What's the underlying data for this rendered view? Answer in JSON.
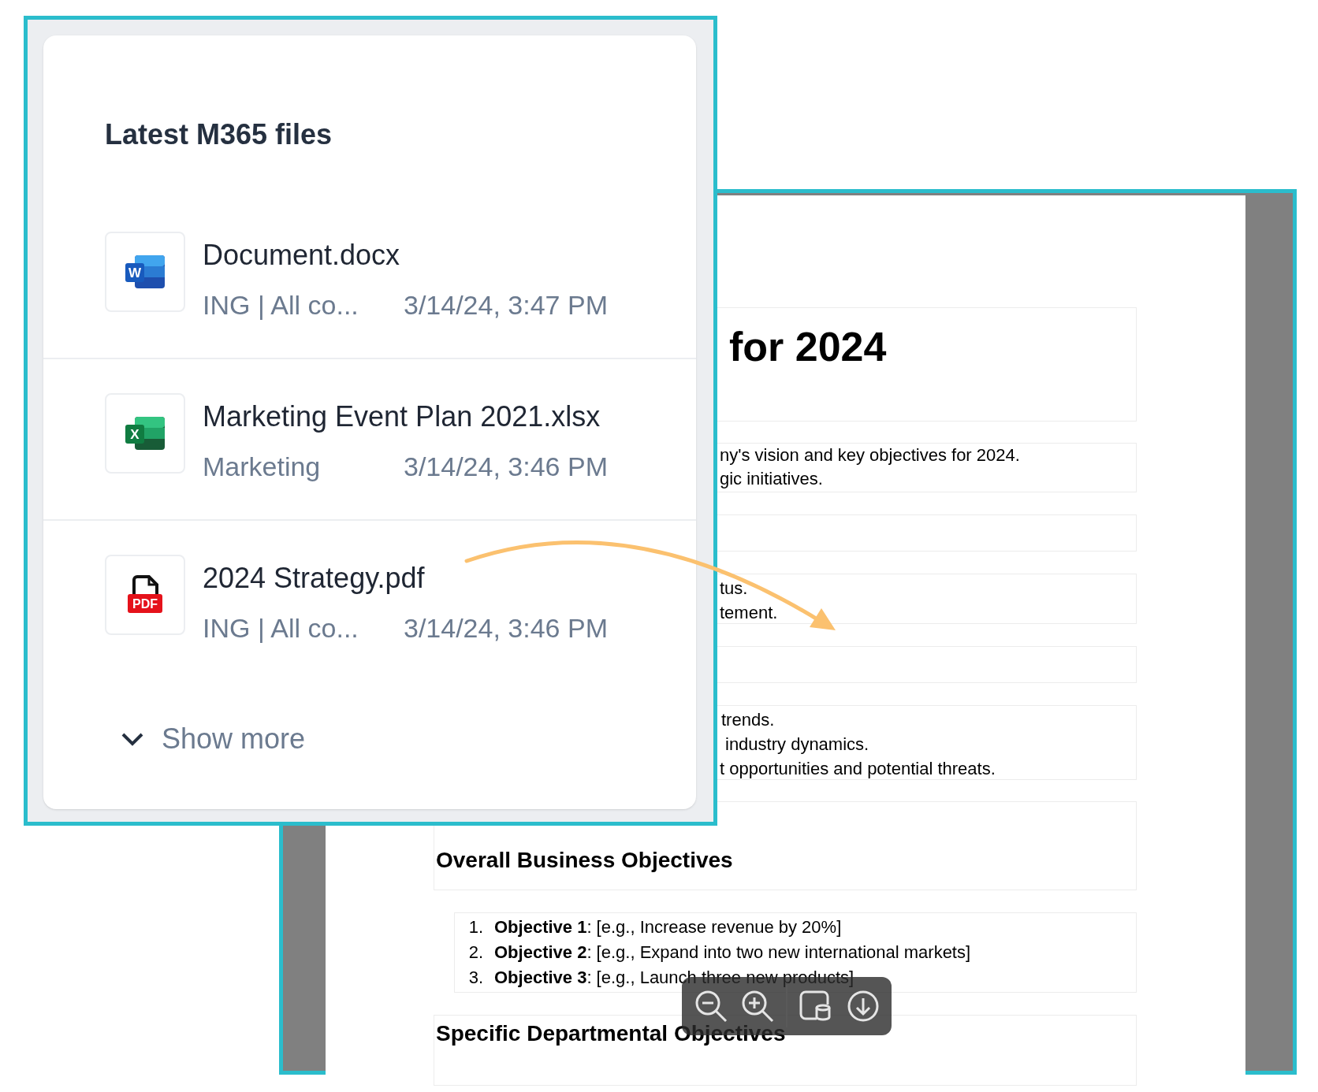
{
  "files_panel": {
    "title": "Latest M365 files",
    "files": [
      {
        "kind": "word",
        "badge": "W",
        "name": "Document.docx",
        "location": "ING | All co...",
        "modified": "3/14/24, 3:47 PM"
      },
      {
        "kind": "excel",
        "badge": "X",
        "name": "Marketing Event Plan 2021.xlsx",
        "location": "Marketing",
        "modified": "3/14/24, 3:46 PM"
      },
      {
        "kind": "pdf",
        "badge": "PDF",
        "name": "2024 Strategy.pdf",
        "location": "ING | All co...",
        "modified": "3/14/24, 3:46 PM"
      }
    ],
    "show_more": "Show more"
  },
  "document": {
    "title": "for 2024",
    "intro_lines": [
      "ny's vision and key objectives for 2024.",
      "gic initiatives."
    ],
    "status_lines": [
      "tus.",
      "tement."
    ],
    "analysis_lines": [
      "trends.",
      "industry dynamics.",
      "t opportunities and potential threats."
    ],
    "subheading": "Overall Business Objectives",
    "objectives": [
      {
        "number": "1.",
        "label": "Objective 1",
        "text": ": [e.g., Increase revenue by 20%]"
      },
      {
        "number": "2.",
        "label": "Objective 2",
        "text": ": [e.g., Expand into two new international markets]"
      },
      {
        "number": "3.",
        "label": "Objective 3",
        "text": ": [e.g., Launch three new products]"
      }
    ],
    "heading": "Specific Departmental Objectives"
  }
}
